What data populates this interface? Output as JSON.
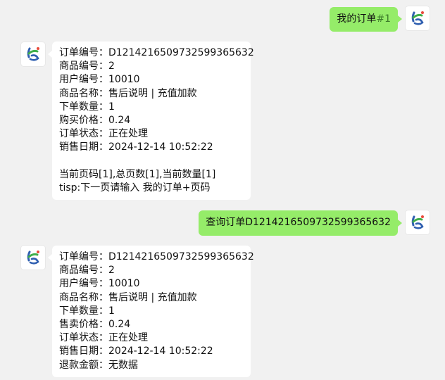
{
  "messages": {
    "m1": {
      "text_main": "我的订单",
      "text_tag": "#1"
    },
    "m2": {
      "lines": [
        "订单编号：D121421650973259936563​2",
        "商品编号：2",
        "用户编号：10010",
        "商品名称：售后说明 | 充值加款",
        "下单数量：1",
        "购买价格：0.24",
        "订单状态：正在处理",
        "销售日期：2024-12-14 10:52:22"
      ],
      "footer": [
        "当前页码[1],总页数[1],当前数量[1]",
        "tisp:下一页请输入 我的订单+页码"
      ]
    },
    "m3": {
      "text": "查询订单D121421650973259936563​2"
    },
    "m4": {
      "lines": [
        "订单编号：D121421650973259936563​2",
        "商品编号：2",
        "用户编号：10010",
        "商品名称：售后说明 | 充值加款",
        "下单数量：1",
        "售卖价格：0.24",
        "订单状态：正在处理",
        "销售日期：2024-12-14 10:52:22",
        "退款金额：无数据"
      ]
    }
  },
  "colors": {
    "background": "#f1f1f1",
    "bubble_self": "#95ec69",
    "bubble_other": "#ffffff"
  },
  "icons": {
    "avatar": "bot-logo-icon"
  }
}
